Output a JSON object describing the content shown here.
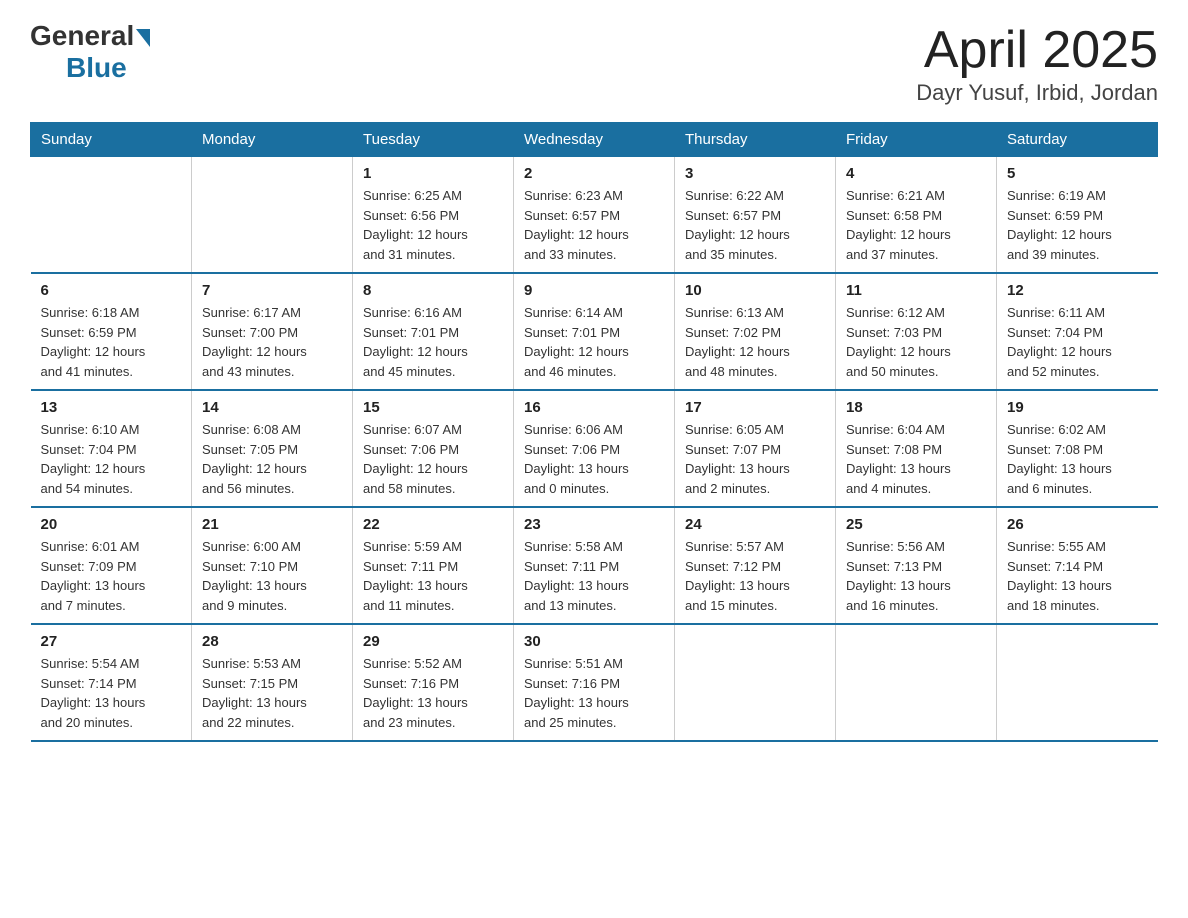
{
  "logo": {
    "general": "General",
    "blue": "Blue"
  },
  "title": "April 2025",
  "subtitle": "Dayr Yusuf, Irbid, Jordan",
  "header_color": "#1a6fa0",
  "days_of_week": [
    "Sunday",
    "Monday",
    "Tuesday",
    "Wednesday",
    "Thursday",
    "Friday",
    "Saturday"
  ],
  "weeks": [
    [
      {
        "num": "",
        "info": ""
      },
      {
        "num": "",
        "info": ""
      },
      {
        "num": "1",
        "info": "Sunrise: 6:25 AM\nSunset: 6:56 PM\nDaylight: 12 hours\nand 31 minutes."
      },
      {
        "num": "2",
        "info": "Sunrise: 6:23 AM\nSunset: 6:57 PM\nDaylight: 12 hours\nand 33 minutes."
      },
      {
        "num": "3",
        "info": "Sunrise: 6:22 AM\nSunset: 6:57 PM\nDaylight: 12 hours\nand 35 minutes."
      },
      {
        "num": "4",
        "info": "Sunrise: 6:21 AM\nSunset: 6:58 PM\nDaylight: 12 hours\nand 37 minutes."
      },
      {
        "num": "5",
        "info": "Sunrise: 6:19 AM\nSunset: 6:59 PM\nDaylight: 12 hours\nand 39 minutes."
      }
    ],
    [
      {
        "num": "6",
        "info": "Sunrise: 6:18 AM\nSunset: 6:59 PM\nDaylight: 12 hours\nand 41 minutes."
      },
      {
        "num": "7",
        "info": "Sunrise: 6:17 AM\nSunset: 7:00 PM\nDaylight: 12 hours\nand 43 minutes."
      },
      {
        "num": "8",
        "info": "Sunrise: 6:16 AM\nSunset: 7:01 PM\nDaylight: 12 hours\nand 45 minutes."
      },
      {
        "num": "9",
        "info": "Sunrise: 6:14 AM\nSunset: 7:01 PM\nDaylight: 12 hours\nand 46 minutes."
      },
      {
        "num": "10",
        "info": "Sunrise: 6:13 AM\nSunset: 7:02 PM\nDaylight: 12 hours\nand 48 minutes."
      },
      {
        "num": "11",
        "info": "Sunrise: 6:12 AM\nSunset: 7:03 PM\nDaylight: 12 hours\nand 50 minutes."
      },
      {
        "num": "12",
        "info": "Sunrise: 6:11 AM\nSunset: 7:04 PM\nDaylight: 12 hours\nand 52 minutes."
      }
    ],
    [
      {
        "num": "13",
        "info": "Sunrise: 6:10 AM\nSunset: 7:04 PM\nDaylight: 12 hours\nand 54 minutes."
      },
      {
        "num": "14",
        "info": "Sunrise: 6:08 AM\nSunset: 7:05 PM\nDaylight: 12 hours\nand 56 minutes."
      },
      {
        "num": "15",
        "info": "Sunrise: 6:07 AM\nSunset: 7:06 PM\nDaylight: 12 hours\nand 58 minutes."
      },
      {
        "num": "16",
        "info": "Sunrise: 6:06 AM\nSunset: 7:06 PM\nDaylight: 13 hours\nand 0 minutes."
      },
      {
        "num": "17",
        "info": "Sunrise: 6:05 AM\nSunset: 7:07 PM\nDaylight: 13 hours\nand 2 minutes."
      },
      {
        "num": "18",
        "info": "Sunrise: 6:04 AM\nSunset: 7:08 PM\nDaylight: 13 hours\nand 4 minutes."
      },
      {
        "num": "19",
        "info": "Sunrise: 6:02 AM\nSunset: 7:08 PM\nDaylight: 13 hours\nand 6 minutes."
      }
    ],
    [
      {
        "num": "20",
        "info": "Sunrise: 6:01 AM\nSunset: 7:09 PM\nDaylight: 13 hours\nand 7 minutes."
      },
      {
        "num": "21",
        "info": "Sunrise: 6:00 AM\nSunset: 7:10 PM\nDaylight: 13 hours\nand 9 minutes."
      },
      {
        "num": "22",
        "info": "Sunrise: 5:59 AM\nSunset: 7:11 PM\nDaylight: 13 hours\nand 11 minutes."
      },
      {
        "num": "23",
        "info": "Sunrise: 5:58 AM\nSunset: 7:11 PM\nDaylight: 13 hours\nand 13 minutes."
      },
      {
        "num": "24",
        "info": "Sunrise: 5:57 AM\nSunset: 7:12 PM\nDaylight: 13 hours\nand 15 minutes."
      },
      {
        "num": "25",
        "info": "Sunrise: 5:56 AM\nSunset: 7:13 PM\nDaylight: 13 hours\nand 16 minutes."
      },
      {
        "num": "26",
        "info": "Sunrise: 5:55 AM\nSunset: 7:14 PM\nDaylight: 13 hours\nand 18 minutes."
      }
    ],
    [
      {
        "num": "27",
        "info": "Sunrise: 5:54 AM\nSunset: 7:14 PM\nDaylight: 13 hours\nand 20 minutes."
      },
      {
        "num": "28",
        "info": "Sunrise: 5:53 AM\nSunset: 7:15 PM\nDaylight: 13 hours\nand 22 minutes."
      },
      {
        "num": "29",
        "info": "Sunrise: 5:52 AM\nSunset: 7:16 PM\nDaylight: 13 hours\nand 23 minutes."
      },
      {
        "num": "30",
        "info": "Sunrise: 5:51 AM\nSunset: 7:16 PM\nDaylight: 13 hours\nand 25 minutes."
      },
      {
        "num": "",
        "info": ""
      },
      {
        "num": "",
        "info": ""
      },
      {
        "num": "",
        "info": ""
      }
    ]
  ]
}
